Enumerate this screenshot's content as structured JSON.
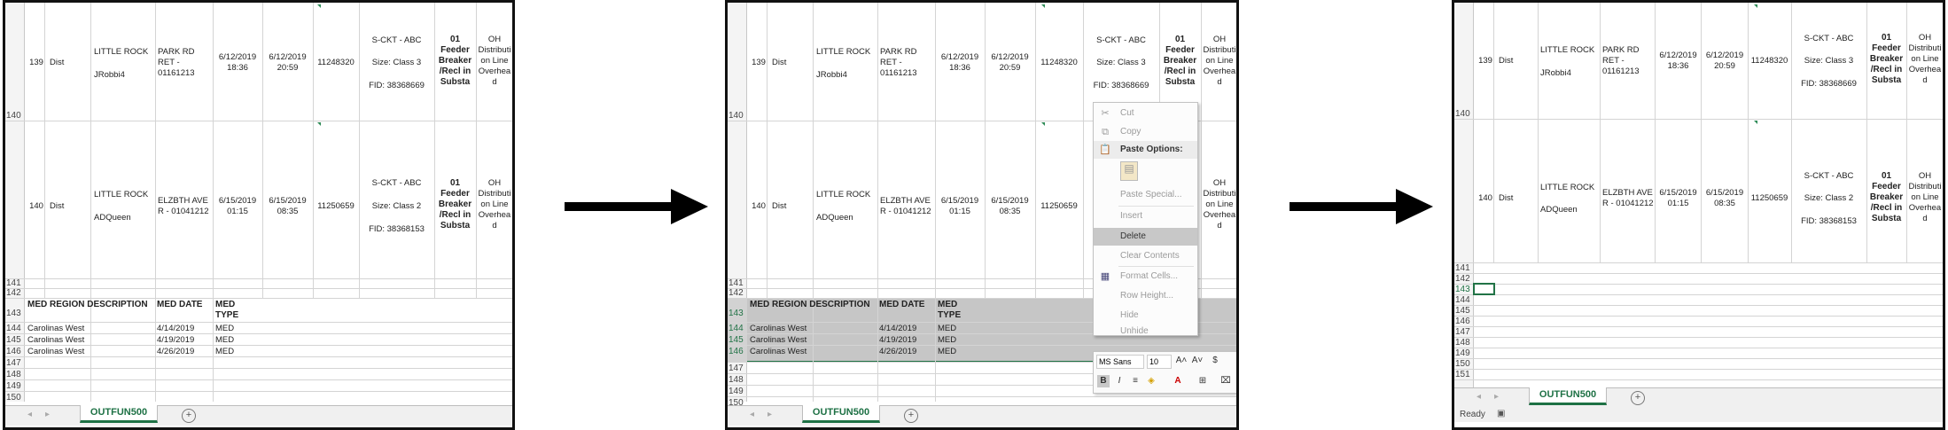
{
  "sheet_tab": "OUTFUN500",
  "rows": {
    "r140": "140",
    "r141": "141",
    "r142": "142",
    "r143": "143",
    "r144": "144",
    "r145": "145",
    "r146": "146",
    "r147": "147",
    "r148": "148",
    "r149": "149",
    "r150": "150",
    "r151": "151"
  },
  "record1": {
    "id": "139",
    "type": "Dist",
    "city": "LITTLE ROCK",
    "user": "JRobbi4",
    "circuit": "PARK RD RET - 01161213",
    "start": "6/12/2019 18:36",
    "end": "6/12/2019 20:59",
    "number": "11248320",
    "sckt": "S-CKT - ABC",
    "size": "Size: Class 3",
    "fid": "FID: 38368669",
    "device": "01 Feeder Breaker /Recl in Substa",
    "oh": "OH Distributi on Line Overhea d"
  },
  "record2": {
    "id": "140",
    "type": "Dist",
    "city": "LITTLE ROCK",
    "user": "ADQueen",
    "circuit": "ELZBTH AVE R - 01041212",
    "start": "6/15/2019 01:15",
    "end": "6/15/2019 08:35",
    "number": "11250659",
    "sckt": "S-CKT - ABC",
    "size": "Size: Class 2",
    "fid": "FID: 38368153",
    "device": "01 Feeder Breaker /Recl in Substa",
    "oh": "OH Distributi on Line Overhea d"
  },
  "med_table": {
    "headers": {
      "region": "MED REGION DESCRIPTION",
      "date": "MED DATE",
      "type": "MED TYPE"
    },
    "rows": [
      {
        "region": "Carolinas West",
        "date": "4/14/2019",
        "type": "MED"
      },
      {
        "region": "Carolinas West",
        "date": "4/19/2019",
        "type": "MED"
      },
      {
        "region": "Carolinas West",
        "date": "4/26/2019",
        "type": "MED"
      }
    ]
  },
  "context_menu": {
    "cut": "Cut",
    "copy": "Copy",
    "paste_options": "Paste Options:",
    "paste_special": "Paste Special...",
    "insert": "Insert",
    "delete": "Delete",
    "clear_contents": "Clear Contents",
    "format_cells": "Format Cells...",
    "row_height": "Row Height...",
    "hide": "Hide",
    "unhide": "Unhide"
  },
  "mini_toolbar": {
    "font": "MS Sans",
    "size": "10"
  },
  "status": {
    "ready": "Ready"
  },
  "icons": [
    "cut-icon",
    "copy-icon",
    "paste-icon",
    "format-cells-icon",
    "add-sheet-icon",
    "arrow-icon"
  ]
}
